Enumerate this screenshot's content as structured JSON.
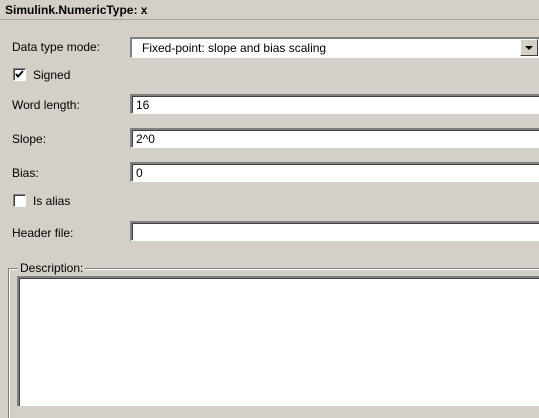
{
  "title": "Simulink.NumericType: x",
  "data_type_mode": {
    "label": "Data type mode:",
    "value": "Fixed-point: slope and bias scaling"
  },
  "signed": {
    "label": "Signed",
    "checked": true
  },
  "word_length": {
    "label": "Word length:",
    "value": "16"
  },
  "slope": {
    "label": "Slope:",
    "value": "2^0"
  },
  "bias": {
    "label": "Bias:",
    "value": "0"
  },
  "is_alias": {
    "label": "Is alias",
    "checked": false
  },
  "header_file": {
    "label": "Header file:",
    "value": ""
  },
  "description": {
    "label": "Description:",
    "value": ""
  }
}
